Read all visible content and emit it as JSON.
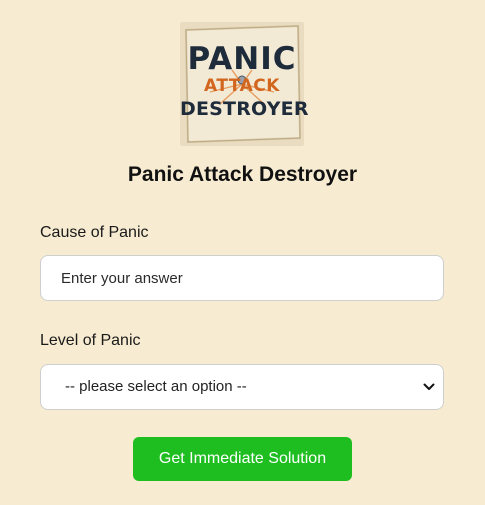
{
  "logo": {
    "line1": "PANIC",
    "line2": "ATTACK",
    "line3": "DESTROYER"
  },
  "app": {
    "title": "Panic Attack Destroyer"
  },
  "form": {
    "cause_label": "Cause of Panic",
    "cause_placeholder": "Enter your answer",
    "cause_value": "",
    "level_label": "Level of Panic",
    "level_selected": "-- please select an option --",
    "submit_label": "Get Immediate Solution"
  },
  "colors": {
    "background": "#f7ecd1",
    "button": "#1ebe21",
    "logo_dark": "#1e2b3a",
    "logo_accent": "#d2661e"
  }
}
